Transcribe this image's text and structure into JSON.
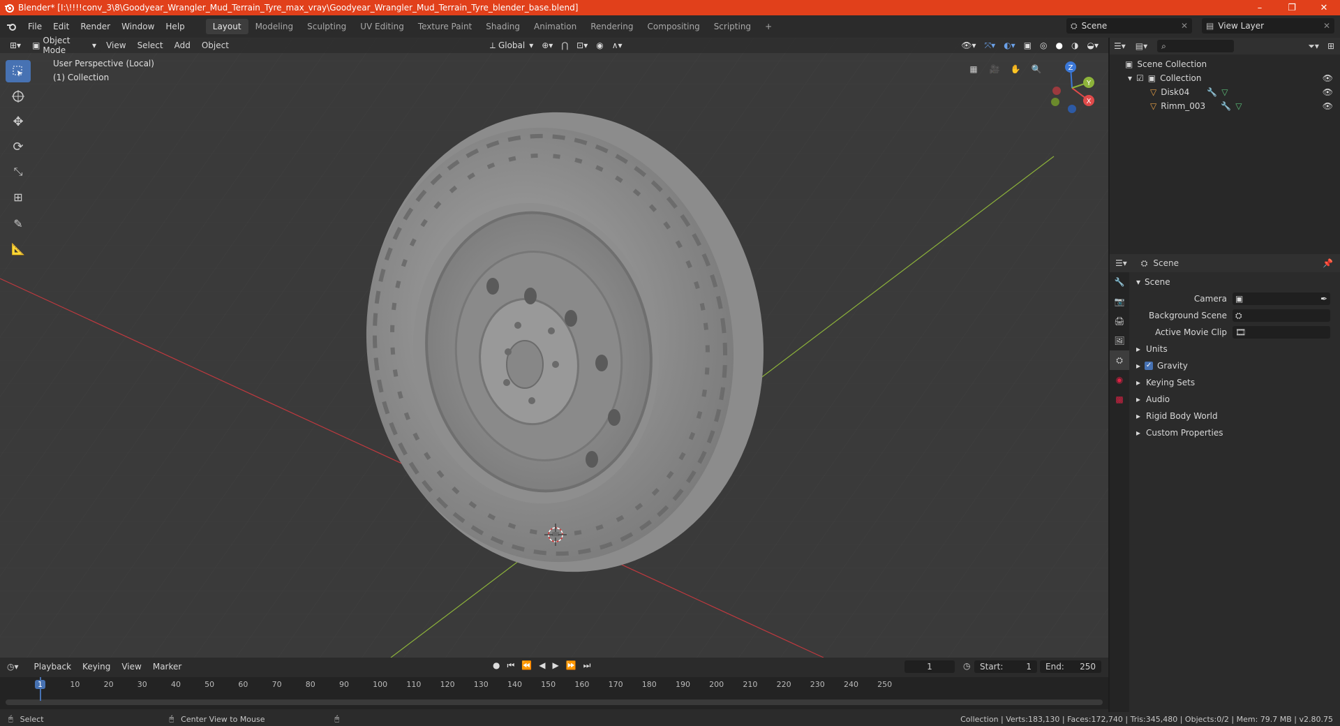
{
  "window": {
    "title": "Blender* [I:\\!!!!conv_3\\8\\Goodyear_Wrangler_Mud_Terrain_Tyre_max_vray\\Goodyear_Wrangler_Mud_Terrain_Tyre_blender_base.blend]",
    "minimize": "–",
    "maximize": "❐",
    "close": "✕"
  },
  "menubar": {
    "items": [
      "File",
      "Edit",
      "Render",
      "Window",
      "Help"
    ]
  },
  "workspaces": {
    "tabs": [
      "Layout",
      "Modeling",
      "Sculpting",
      "UV Editing",
      "Texture Paint",
      "Shading",
      "Animation",
      "Rendering",
      "Compositing",
      "Scripting"
    ],
    "active": "Layout",
    "add": "+"
  },
  "scene_selector": {
    "value": "Scene"
  },
  "view_layer_selector": {
    "value": "View Layer"
  },
  "viewport_header": {
    "mode": "Object Mode",
    "menus": [
      "View",
      "Select",
      "Add",
      "Object"
    ],
    "transform_orientation": "Global"
  },
  "viewport": {
    "perspective_label": "User Perspective (Local)",
    "collection_label": "(1) Collection",
    "gizmo_axes": {
      "x": "X",
      "y": "Y",
      "z": "Z"
    }
  },
  "outliner": {
    "search_placeholder": "",
    "root": "Scene Collection",
    "collection": "Collection",
    "objects": [
      "Disk04",
      "Rimm_003"
    ]
  },
  "properties": {
    "header_title": "Scene",
    "section_title": "Scene",
    "fields": {
      "camera": "Camera",
      "background_scene": "Background Scene",
      "active_movie_clip": "Active Movie Clip"
    },
    "panels": [
      "Units",
      "Gravity",
      "Keying Sets",
      "Audio",
      "Rigid Body World",
      "Custom Properties"
    ],
    "gravity_checked": true
  },
  "timeline": {
    "menus": [
      "Playback",
      "Keying",
      "View",
      "Marker"
    ],
    "current_frame": "1",
    "start_label": "Start:",
    "start_value": "1",
    "end_label": "End:",
    "end_value": "250",
    "ruler": [
      "1",
      "10",
      "20",
      "30",
      "40",
      "50",
      "60",
      "70",
      "80",
      "90",
      "100",
      "110",
      "120",
      "130",
      "140",
      "150",
      "160",
      "170",
      "180",
      "190",
      "200",
      "210",
      "220",
      "230",
      "240",
      "250"
    ]
  },
  "statusbar": {
    "select": "Select",
    "center_view": "Center View to Mouse",
    "stats": "Collection | Verts:183,130 | Faces:172,740 | Tris:345,480 | Objects:0/2 | Mem: 79.7 MB | v2.80.75"
  },
  "colors": {
    "titlebar": "#e1401b",
    "accent": "#4772b3",
    "viewport_bg": "#3a3a3a",
    "x_axis": "#c0393f",
    "y_axis": "#8db33a"
  }
}
